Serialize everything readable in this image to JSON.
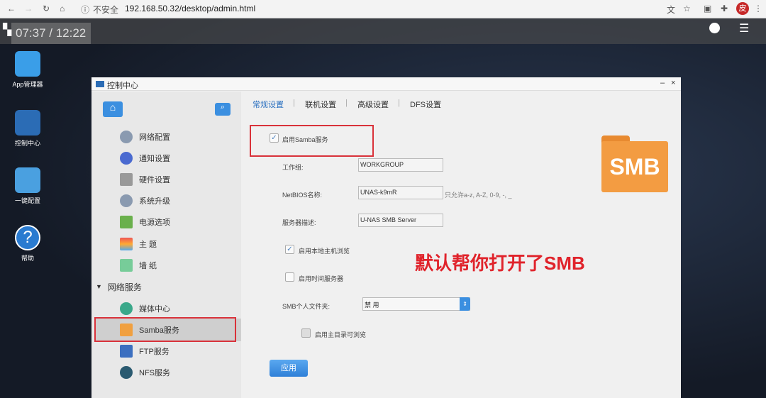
{
  "browser": {
    "security": "不安全",
    "url": "192.168.50.32/desktop/admin.html",
    "profile": "皮"
  },
  "desktop": {
    "clock": "07:37 / 12:22",
    "icons": [
      {
        "label": "App管理器"
      },
      {
        "label": "控制中心"
      },
      {
        "label": "一键配置"
      },
      {
        "label": "帮助"
      }
    ]
  },
  "window": {
    "title": "控制中心",
    "sidebar": {
      "items": [
        "网络配置",
        "通知设置",
        "硬件设置",
        "系统升级",
        "电源选项",
        "主 题",
        "墙 纸"
      ],
      "section": "网络服务",
      "service_items": [
        "媒体中心",
        "Samba服务",
        "FTP服务",
        "NFS服务"
      ]
    },
    "tabs": [
      "常规设置",
      "联机设置",
      "高级设置",
      "DFS设置"
    ],
    "form": {
      "enable_samba": "启用Samba服务",
      "workgroup_label": "工作组:",
      "workgroup": "WORKGROUP",
      "netbios_label": "NetBIOS名称:",
      "netbios": "UNAS-k9mR",
      "netbios_hint": "只允许a-z, A-Z, 0-9, -, _",
      "desc_label": "服务器描述:",
      "desc": "U-NAS SMB Server",
      "local_browse": "启用本地主机浏览",
      "time_server": "启用时间服务器",
      "personal_folder_label": "SMB个人文件夹:",
      "personal_folder": "禁 用",
      "home_browse": "启用主目录可浏览",
      "apply": "应用"
    },
    "folder_label": "SMB",
    "annotation": "默认帮你打开了SMB"
  },
  "colors": {
    "accent": "#3b8fe0",
    "highlight": "#d9323a"
  }
}
